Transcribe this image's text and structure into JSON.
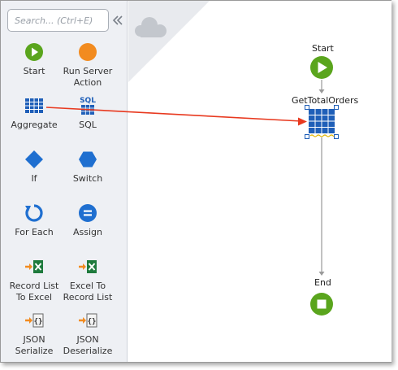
{
  "toolbox": {
    "search_placeholder": "Search... (Ctrl+E)",
    "tools": [
      {
        "label": "Start"
      },
      {
        "label": "Run Server Action"
      },
      {
        "label": "Aggregate"
      },
      {
        "label": "SQL",
        "icon_text": "SQL"
      },
      {
        "label": "If"
      },
      {
        "label": "Switch"
      },
      {
        "label": "For Each"
      },
      {
        "label": "Assign"
      },
      {
        "label": "Record List To Excel"
      },
      {
        "label": "Excel To Record List"
      },
      {
        "label": "JSON Serialize"
      },
      {
        "label": "JSON Deserialize"
      }
    ]
  },
  "flow": {
    "start_label": "Start",
    "aggregate_label": "GetTotalOrders",
    "end_label": "End"
  },
  "colors": {
    "green": "#5aa51d",
    "orange": "#f28b1f",
    "blue": "#1f5fb8",
    "drag_line": "#e8391f"
  }
}
